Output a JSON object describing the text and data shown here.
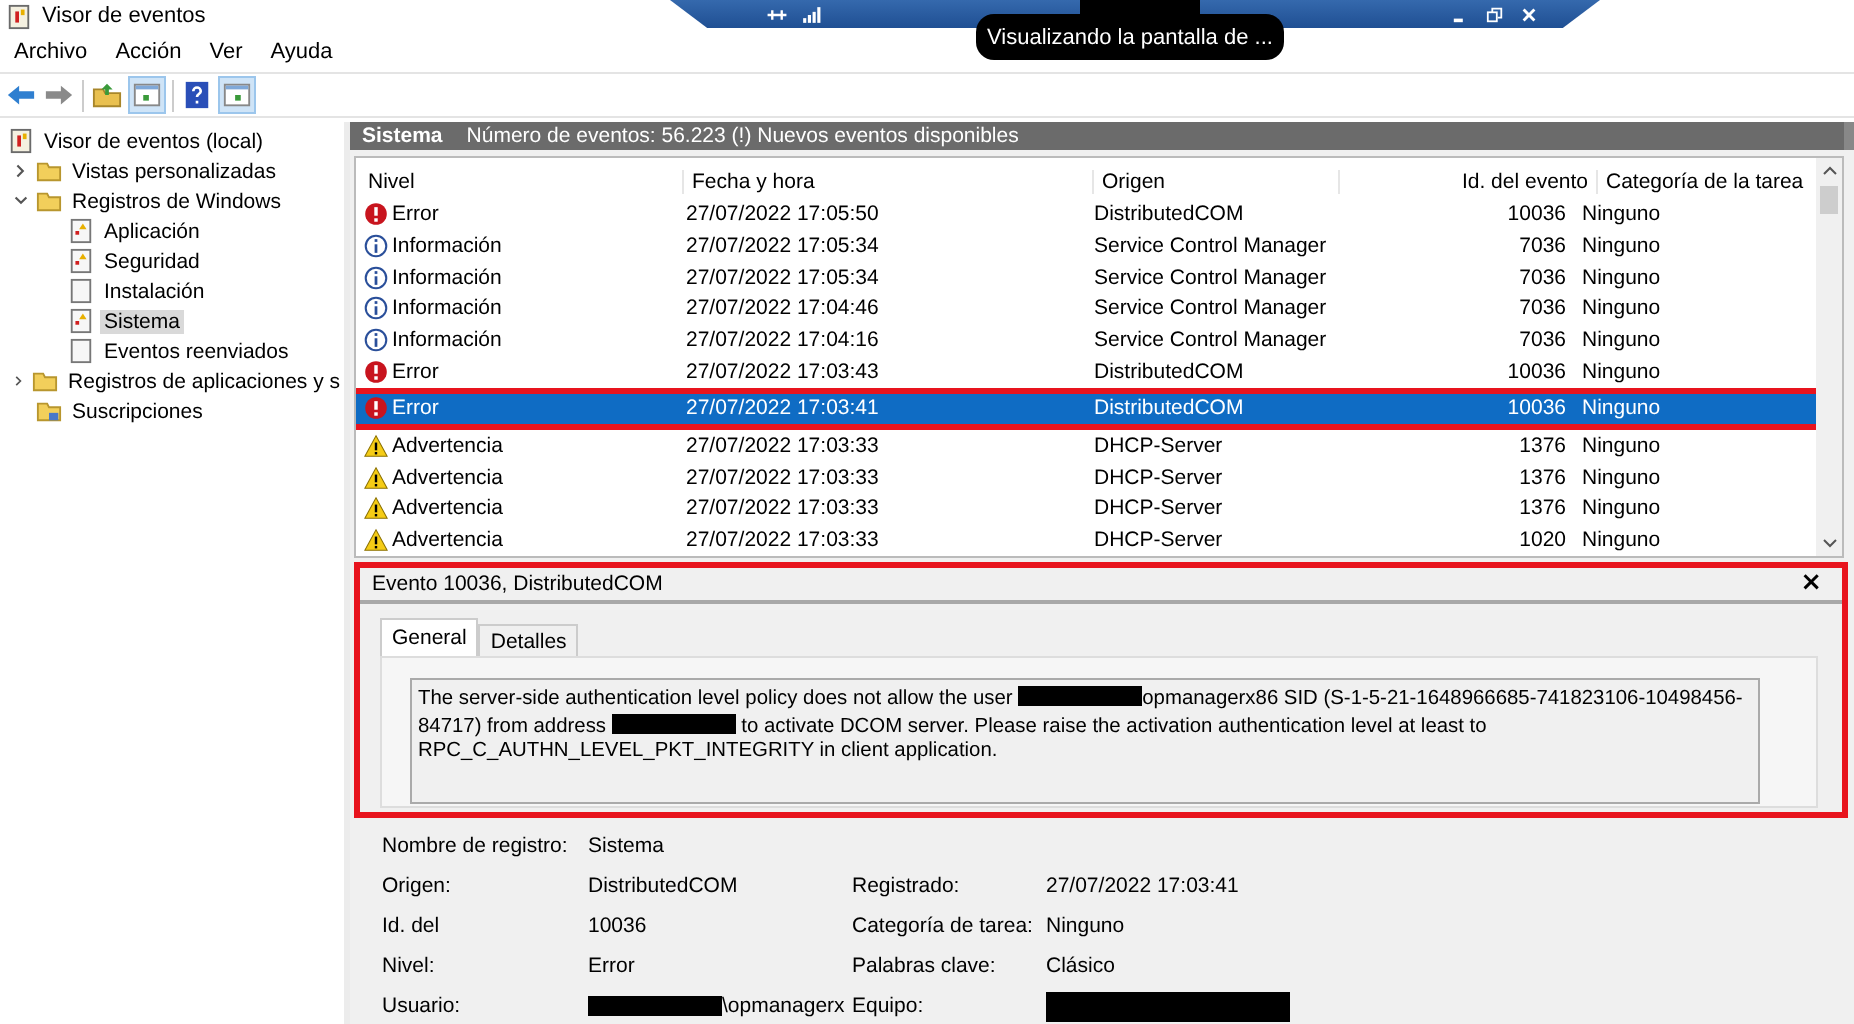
{
  "window": {
    "title": "Visor de eventos"
  },
  "remote_bar": {
    "tooltip": "Visualizando la pantalla de ..."
  },
  "menu": [
    "Archivo",
    "Acción",
    "Ver",
    "Ayuda"
  ],
  "tree": [
    {
      "label": "Visor de eventos (local)",
      "kind": "root",
      "selected": false,
      "children": [
        {
          "label": "Vistas personalizadas",
          "kind": "folder",
          "expanded": false,
          "selected": false
        },
        {
          "label": "Registros de Windows",
          "kind": "folder",
          "expanded": true,
          "selected": false,
          "children": [
            {
              "label": "Aplicación",
              "kind": "log",
              "selected": false
            },
            {
              "label": "Seguridad",
              "kind": "log",
              "selected": false
            },
            {
              "label": "Instalación",
              "kind": "plain_log",
              "selected": false
            },
            {
              "label": "Sistema",
              "kind": "log",
              "selected": true
            },
            {
              "label": "Eventos reenviados",
              "kind": "plain_log",
              "selected": false
            }
          ]
        },
        {
          "label": "Registros de aplicaciones y s",
          "kind": "folder",
          "expanded": false,
          "selected": false
        },
        {
          "label": "Suscripciones",
          "kind": "subscriptions",
          "selected": false
        }
      ]
    }
  ],
  "log_header": {
    "name": "Sistema",
    "info": "Número de eventos: 56.223 (!) Nuevos eventos disponibles"
  },
  "table": {
    "columns": [
      "Nivel",
      "Fecha y hora",
      "Origen",
      "Id. del evento",
      "Categoría de la tarea"
    ],
    "rows": [
      {
        "kind": "error",
        "level": "Error",
        "date": "27/07/2022 17:05:50",
        "source": "DistributedCOM",
        "id": "10036",
        "category": "Ninguno",
        "selected": false
      },
      {
        "kind": "info",
        "level": "Información",
        "date": "27/07/2022 17:05:34",
        "source": "Service Control Manager",
        "id": "7036",
        "category": "Ninguno",
        "selected": false
      },
      {
        "kind": "info",
        "level": "Información",
        "date": "27/07/2022 17:05:34",
        "source": "Service Control Manager",
        "id": "7036",
        "category": "Ninguno",
        "selected": false
      },
      {
        "kind": "info",
        "level": "Información",
        "date": "27/07/2022 17:04:46",
        "source": "Service Control Manager",
        "id": "7036",
        "category": "Ninguno",
        "selected": false
      },
      {
        "kind": "info",
        "level": "Información",
        "date": "27/07/2022 17:04:16",
        "source": "Service Control Manager",
        "id": "7036",
        "category": "Ninguno",
        "selected": false
      },
      {
        "kind": "error",
        "level": "Error",
        "date": "27/07/2022 17:03:43",
        "source": "DistributedCOM",
        "id": "10036",
        "category": "Ninguno",
        "selected": false
      },
      {
        "kind": "error",
        "level": "Error",
        "date": "27/07/2022 17:03:41",
        "source": "DistributedCOM",
        "id": "10036",
        "category": "Ninguno",
        "selected": true
      },
      {
        "kind": "warning",
        "level": "Advertencia",
        "date": "27/07/2022 17:03:33",
        "source": "DHCP-Server",
        "id": "1376",
        "category": "Ninguno",
        "selected": false
      },
      {
        "kind": "warning",
        "level": "Advertencia",
        "date": "27/07/2022 17:03:33",
        "source": "DHCP-Server",
        "id": "1376",
        "category": "Ninguno",
        "selected": false
      },
      {
        "kind": "warning",
        "level": "Advertencia",
        "date": "27/07/2022 17:03:33",
        "source": "DHCP-Server",
        "id": "1376",
        "category": "Ninguno",
        "selected": false
      },
      {
        "kind": "warning",
        "level": "Advertencia",
        "date": "27/07/2022 17:03:33",
        "source": "DHCP-Server",
        "id": "1020",
        "category": "Ninguno",
        "selected": false
      }
    ]
  },
  "detail": {
    "title": "Evento 10036, DistributedCOM",
    "close": "×",
    "tabs": [
      {
        "label": "General",
        "selected": true
      },
      {
        "label": "Detalles",
        "selected": false
      }
    ],
    "message": [
      {
        "kind": "text",
        "text": "The server-side authentication level policy does not allow the user "
      },
      {
        "kind": "redacted"
      },
      {
        "kind": "text",
        "text": "opmanagerx86 SID (S-1-5-21-1648966685-741823106-10498456-84717) from address "
      },
      {
        "kind": "redacted"
      },
      {
        "kind": "text",
        "text": " to activate DCOM server. Please raise the activation authentication level at least to RPC_C_AUTHN_LEVEL_PKT_INTEGRITY in client application."
      }
    ],
    "properties": [
      [
        {
          "label": "Nombre de registro:",
          "value": "Sistema"
        }
      ],
      [
        {
          "label": "Origen:",
          "value": "DistributedCOM"
        },
        {
          "label": "Registrado:",
          "value": "27/07/2022 17:03:41"
        }
      ],
      [
        {
          "label": "Id. del",
          "value": "10036"
        },
        {
          "label": "Categoría de tarea:",
          "value": "Ninguno"
        }
      ],
      [
        {
          "label": "Nivel:",
          "value": "Error"
        },
        {
          "label": "Palabras clave:",
          "value": "Clásico"
        }
      ],
      [
        {
          "label": "Usuario:",
          "value": "\\opmanagerx",
          "redacted": true
        },
        {
          "label": "Equipo:",
          "redacted": true
        }
      ]
    ]
  }
}
